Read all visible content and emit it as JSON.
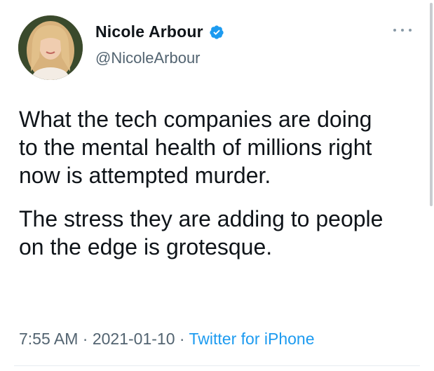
{
  "author": {
    "display_name": "Nicole Arbour",
    "handle": "@NicoleArbour",
    "verified": true,
    "verified_color": "#1d9bf0",
    "avatar_icon": "profile-photo"
  },
  "tweet": {
    "paragraphs": [
      "What the tech companies are doing\nto the mental health of millions right\nnow is attempted murder.",
      "The stress they are adding to people\non the edge is grotesque."
    ]
  },
  "meta": {
    "time": "7:55 AM",
    "separator": " · ",
    "date": "2021-01-10",
    "source": "Twitter for iPhone",
    "source_color": "#1d9bf0"
  },
  "icons": {
    "more": "more-options-icon",
    "verified": "verified-badge-icon"
  }
}
